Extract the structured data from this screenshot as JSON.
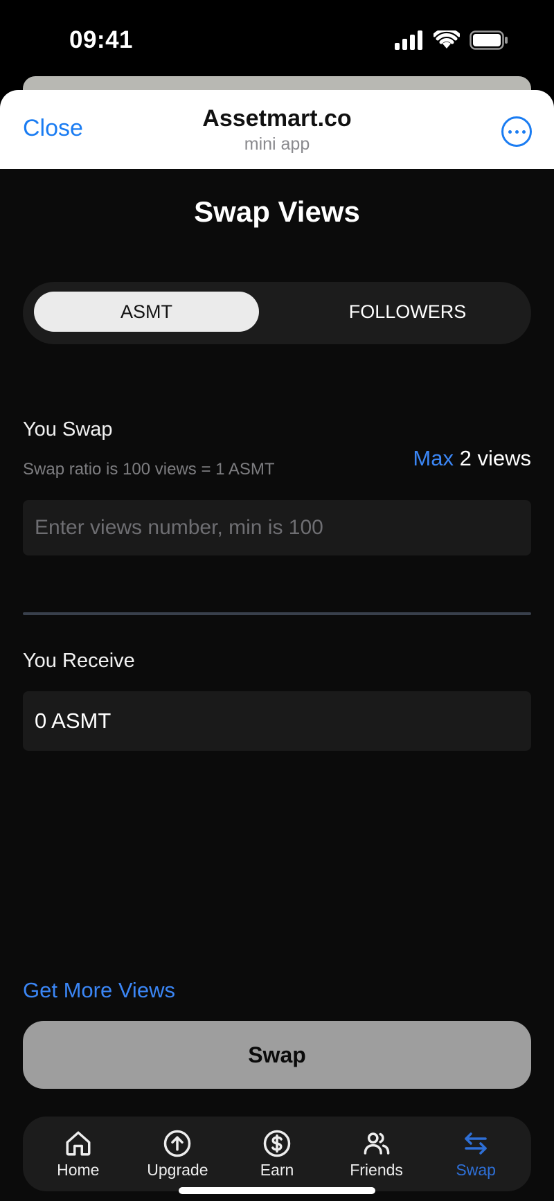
{
  "status_bar": {
    "time": "09:41"
  },
  "header": {
    "close_label": "Close",
    "title": "Assetmart.co",
    "subtitle": "mini app"
  },
  "main": {
    "title": "Swap Views",
    "tabs": [
      {
        "label": "ASMT",
        "selected": true
      },
      {
        "label": "FOLLOWERS",
        "selected": false
      }
    ],
    "swap": {
      "label": "You Swap",
      "ratio_text": "Swap ratio is 100 views = 1 ASMT",
      "max_label": "Max",
      "available": "2 views",
      "input_value": "",
      "input_placeholder": "Enter views number, min is 100"
    },
    "receive": {
      "label": "You Receive",
      "value": "0 ASMT"
    },
    "get_more_label": "Get More Views",
    "swap_button_label": "Swap"
  },
  "nav": {
    "items": [
      {
        "label": "Home",
        "icon": "home-icon",
        "active": false
      },
      {
        "label": "Upgrade",
        "icon": "arrow-up-circle-icon",
        "active": false
      },
      {
        "label": "Earn",
        "icon": "dollar-circle-icon",
        "active": false
      },
      {
        "label": "Friends",
        "icon": "users-icon",
        "active": false
      },
      {
        "label": "Swap",
        "icon": "swap-arrows-icon",
        "active": true
      }
    ]
  },
  "colors": {
    "accent": "#1a7cf2",
    "link": "#3b86f5",
    "nav_active": "#2e6fd6",
    "background": "#0b0b0b",
    "swap_button": "#9e9e9e"
  }
}
